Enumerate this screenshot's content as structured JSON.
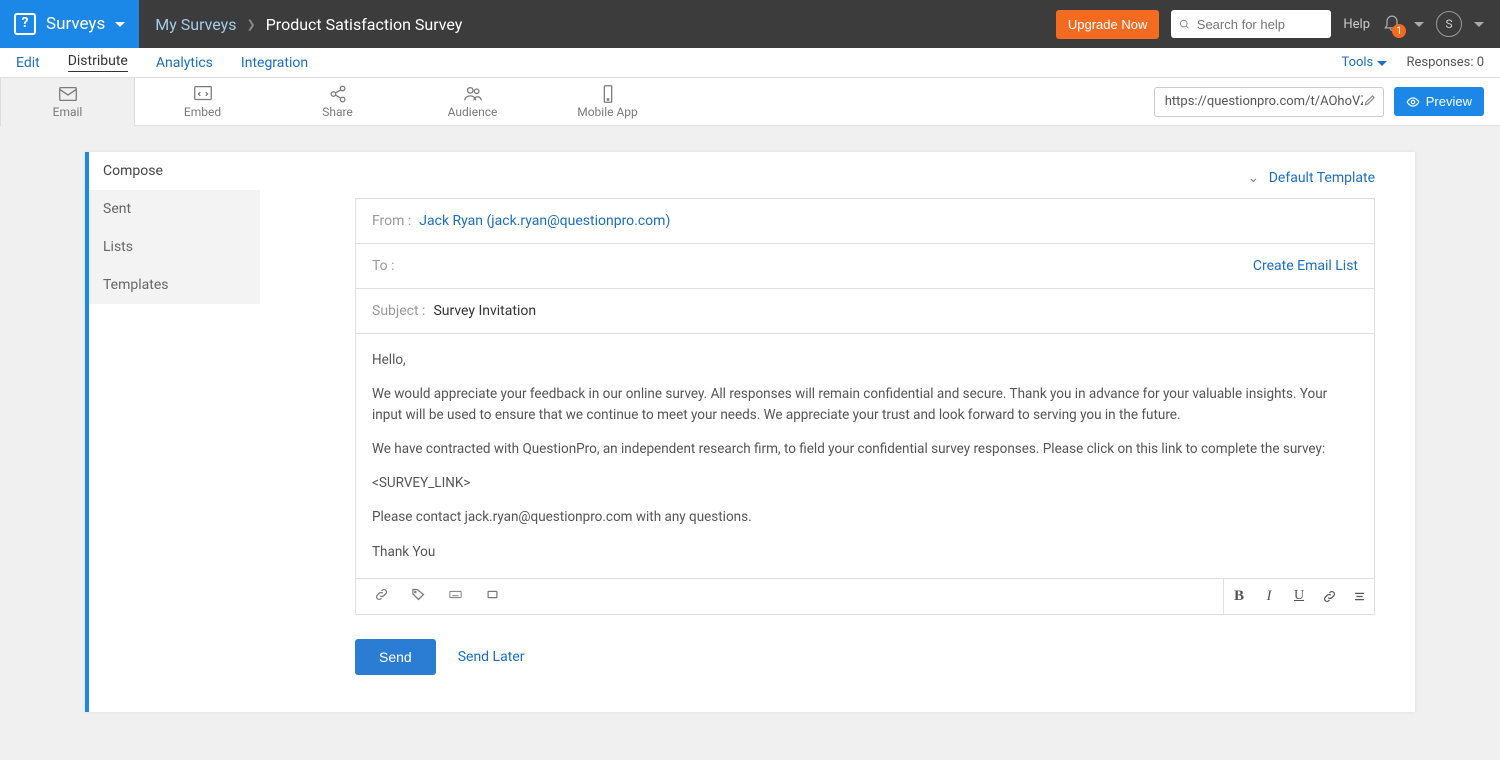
{
  "topbar": {
    "brand": "Surveys",
    "breadcrumb_root": "My Surveys",
    "title": "Product Satisfaction Survey",
    "upgrade": "Upgrade Now",
    "search_placeholder": "Search for help",
    "help": "Help",
    "notif_count": "1",
    "avatar_letter": "S"
  },
  "nav": {
    "tabs": [
      "Edit",
      "Distribute",
      "Analytics",
      "Integration"
    ],
    "tools": "Tools",
    "responses": "Responses: 0"
  },
  "subnav": {
    "items": [
      "Email",
      "Embed",
      "Share",
      "Audience",
      "Mobile App"
    ],
    "url": "https://questionpro.com/t/AOhoVZ",
    "preview": "Preview"
  },
  "sidebar": {
    "items": [
      "Compose",
      "Sent",
      "Lists",
      "Templates"
    ]
  },
  "compose": {
    "template_label": "Default Template",
    "from_label": "From :",
    "from_value": "Jack Ryan (jack.ryan@questionpro.com)",
    "to_label": "To :",
    "create_list": "Create Email List",
    "subject_label": "Subject :",
    "subject_value": "Survey Invitation",
    "body": {
      "p1": "Hello,",
      "p2": "We would appreciate your feedback in our online survey.  All responses will remain confidential and secure.  Thank you in advance for your valuable insights.  Your input will be used to ensure that we continue to meet your needs. We appreciate your trust and look forward to serving you in the future.",
      "p3": "We have contracted with QuestionPro, an independent research firm, to field your confidential survey responses.  Please click on this link to complete the survey:",
      "p4": "<SURVEY_LINK>",
      "p5": "Please contact jack.ryan@questionpro.com with any questions.",
      "p6": "Thank You"
    },
    "send": "Send",
    "send_later": "Send Later"
  }
}
